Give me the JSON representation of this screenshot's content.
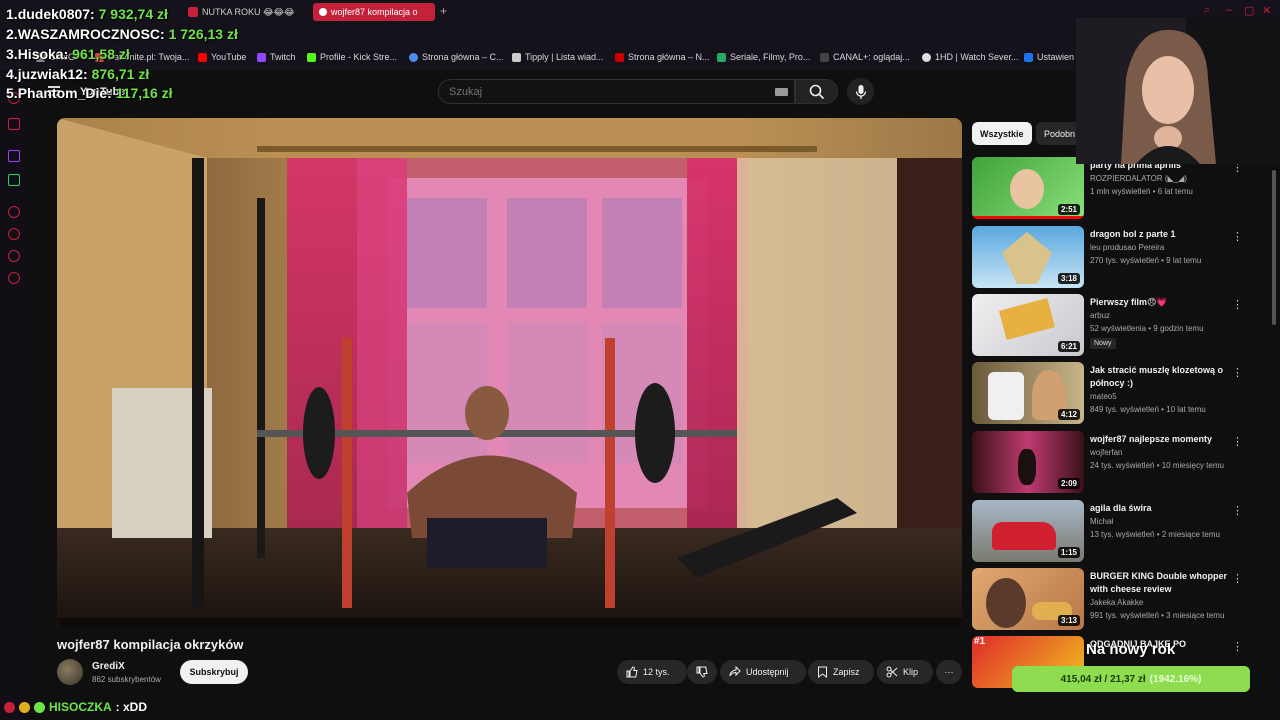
{
  "browser": {
    "tabs": [
      {
        "label": "NUTKA ROKU 😂😂😂"
      },
      {
        "label": "wojfer87 kompilacja o"
      }
    ],
    "bookmarks": [
      "ChatGPT",
      "Patronite.pl: Twoja...",
      "YouTube",
      "Twitch",
      "Profile - Kick Stre...",
      "Strona główna – C...",
      "Tipply | Lista wiad...",
      "Strona główna – N...",
      "Seriale, Filmy, Pro...",
      "CANAL+: oglądaj...",
      "1HD | Watch Sever...",
      "Ustawien"
    ]
  },
  "youtube": {
    "logo": "YouTube",
    "search_placeholder": "Szukaj"
  },
  "video": {
    "title": "wojfer87 kompilacja okrzyków",
    "channel": "GrediX",
    "subscribers": "862 subskrybentów",
    "subscribe_label": "Subskrybuj",
    "likes": "12 tys.",
    "share_label": "Udostępnij",
    "save_label": "Zapisz",
    "clip_label": "Klip"
  },
  "sidebar": {
    "chips": [
      "Wszystkie",
      "Podobn"
    ],
    "recommendations": [
      {
        "title": "party na prima aprilis",
        "channel": "ROZPIERDALATOR (◣_◢)",
        "meta": "1 mln wyświetleń • 6 lat temu",
        "duration": "2:51"
      },
      {
        "title": "dragon bol z parte 1",
        "channel": "leu produsao Pereira",
        "meta": "270 tys. wyświetleń • 9 lat temu",
        "duration": "3:18"
      },
      {
        "title": "Pierwszy film😠💗",
        "channel": "arbuz",
        "meta": "52 wyświetlenia • 9 godzin temu",
        "duration": "6:21",
        "badge": "Nowy"
      },
      {
        "title": "Jak stracić muszlę klozetową o północy :)",
        "channel": "mateo5",
        "meta": "849 tys. wyświetleń • 10 lat temu",
        "duration": "4:12"
      },
      {
        "title": "wojfer87 najlepsze momenty",
        "channel": "wojferfan",
        "meta": "24 tys. wyświetleń • 10 miesięcy temu",
        "duration": "2:09"
      },
      {
        "title": "agila dla świra",
        "channel": "Michał",
        "meta": "13 tys. wyświetleń • 2 miesiące temu",
        "duration": "1:15"
      },
      {
        "title": "BURGER KING Double whopper with cheese review",
        "channel": "Jakeka Akakke",
        "meta": "991 tys. wyświetleń • 3 miesiące temu",
        "duration": "3:13"
      },
      {
        "title": "ODGADNIJ BAJKE PO",
        "channel": "",
        "meta": "",
        "duration": "",
        "rank": "#1"
      }
    ]
  },
  "overlay": {
    "leaderboard": [
      {
        "rank": "1.",
        "name": "dudek0807:",
        "amount": "7 932,74 zł"
      },
      {
        "rank": "2.",
        "name": "WASZAMROCZNOSC:",
        "amount": "1 726,13 zł"
      },
      {
        "rank": "3.",
        "name": "Hisoka:",
        "amount": "961,58 zł"
      },
      {
        "rank": "4.",
        "name": "juzwiak12:",
        "amount": "876,71 zł"
      },
      {
        "rank": "5.",
        "name": "Phantom_Die:",
        "amount": "117,16 zł"
      }
    ],
    "goal": {
      "label": "Na nowy rok",
      "text": "415,04 zł / 21,37 zł",
      "percent": "(1942.16%)",
      "progress": 1.0
    },
    "chat": {
      "user": "HISOCZKA",
      "message": ": xDD"
    }
  },
  "colors": {
    "accent": "#c4213a",
    "money": "#6fe34a",
    "goal": "#8edc4f"
  }
}
